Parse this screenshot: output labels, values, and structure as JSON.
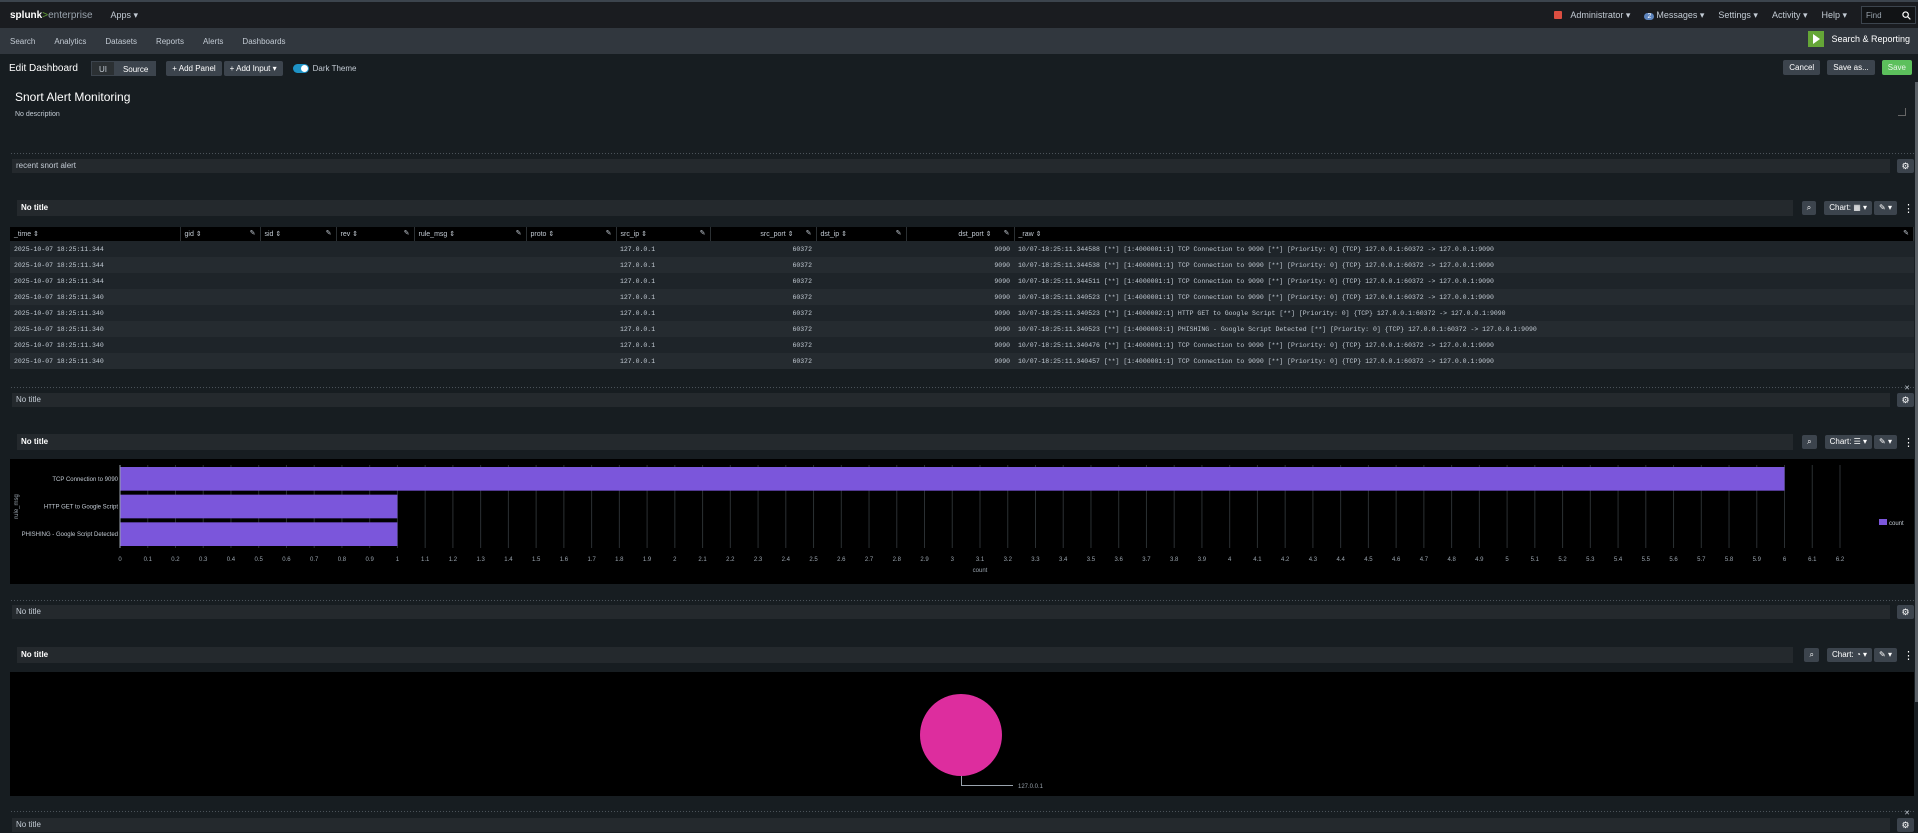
{
  "topbar": {
    "logo_main": "splunk",
    "logo_sep": ">",
    "logo_suffix": "enterprise",
    "apps": "Apps ▾",
    "user": "Administrator ▾",
    "messages_count": "2",
    "messages": "Messages ▾",
    "settings": "Settings ▾",
    "activity": "Activity ▾",
    "help": "Help ▾",
    "find_placeholder": "Find"
  },
  "nav": {
    "items": [
      "Search",
      "Analytics",
      "Datasets",
      "Reports",
      "Alerts",
      "Dashboards"
    ],
    "app_title": "Search & Reporting"
  },
  "editbar": {
    "title": "Edit Dashboard",
    "ui": "UI",
    "source": "Source",
    "add_panel": "+ Add Panel",
    "add_input": "+ Add Input ▾",
    "dark_theme": "Dark Theme",
    "cancel": "Cancel",
    "save_as": "Save as...",
    "save": "Save"
  },
  "dashboard": {
    "title": "Snort Alert Monitoring",
    "description": "No description"
  },
  "rows": [
    {
      "row_title": "recent snort alert",
      "panel_title": "No title",
      "chart_label": "Chart: ▦ ▾"
    },
    {
      "row_title": "No title",
      "panel_title": "No title",
      "chart_label": "Chart: ☰ ▾"
    },
    {
      "row_title": "No title",
      "panel_title": "No title",
      "chart_label": "Chart: ◔ ▾"
    },
    {
      "row_title": "No title"
    }
  ],
  "table": {
    "columns": [
      "_time ⇕",
      "gid ⇕",
      "sid ⇕",
      "rev ⇕",
      "rule_msg ⇕",
      "proto ⇕",
      "src_ip ⇕",
      "src_port ⇕",
      "dst_ip ⇕",
      "dst_port ⇕",
      "_raw ⇕"
    ],
    "rows": [
      [
        "2025-10-07 18:25:11.344",
        "127.0.0.1",
        "60372",
        "9090",
        "10/07-18:25:11.344588  [**] [1:4000001:1] TCP Connection to 9090 [**] [Priority: 0] {TCP} 127.0.0.1:60372 -> 127.0.0.1:9090"
      ],
      [
        "2025-10-07 18:25:11.344",
        "127.0.0.1",
        "60372",
        "9090",
        "10/07-18:25:11.344538  [**] [1:4000001:1] TCP Connection to 9090 [**] [Priority: 0] {TCP} 127.0.0.1:60372 -> 127.0.0.1:9090"
      ],
      [
        "2025-10-07 18:25:11.344",
        "127.0.0.1",
        "60372",
        "9090",
        "10/07-18:25:11.344511  [**] [1:4000001:1] TCP Connection to 9090 [**] [Priority: 0] {TCP} 127.0.0.1:60372 -> 127.0.0.1:9090"
      ],
      [
        "2025-10-07 18:25:11.340",
        "127.0.0.1",
        "60372",
        "9090",
        "10/07-18:25:11.340523  [**] [1:4000001:1] TCP Connection to 9090 [**] [Priority: 0] {TCP} 127.0.0.1:60372 -> 127.0.0.1:9090"
      ],
      [
        "2025-10-07 18:25:11.340",
        "127.0.0.1",
        "60372",
        "9090",
        "10/07-18:25:11.340523  [**] [1:4000002:1] HTTP GET to Google Script [**] [Priority: 0] {TCP} 127.0.0.1:60372 -> 127.0.0.1:9090"
      ],
      [
        "2025-10-07 18:25:11.340",
        "127.0.0.1",
        "60372",
        "9090",
        "10/07-18:25:11.340523  [**] [1:4000003:1] PHISHING - Google Script Detected [**] [Priority: 0] {TCP} 127.0.0.1:60372 -> 127.0.0.1:9090"
      ],
      [
        "2025-10-07 18:25:11.340",
        "127.0.0.1",
        "60372",
        "9090",
        "10/07-18:25:11.340476  [**] [1:4000001:1] TCP Connection to 9090 [**] [Priority: 0] {TCP} 127.0.0.1:60372 -> 127.0.0.1:9090"
      ],
      [
        "2025-10-07 18:25:11.340",
        "127.0.0.1",
        "60372",
        "9090",
        "10/07-18:25:11.340457  [**] [1:4000001:1] TCP Connection to 9090 [**] [Priority: 0] {TCP} 127.0.0.1:60372 -> 127.0.0.1:9090"
      ]
    ]
  },
  "chart_data": [
    {
      "type": "bar",
      "orientation": "horizontal",
      "categories": [
        "TCP Connection to 9090",
        "HTTP GET to Google Script",
        "PHISHING - Google Script Detected"
      ],
      "values": [
        6,
        1,
        1
      ],
      "xlabel": "count",
      "ylabel": "rule_msg",
      "xlim": [
        0,
        6.2
      ],
      "tick_step": 0.1,
      "legend": [
        "count"
      ],
      "legend_position": "right",
      "color": "#7b56db",
      "grid": true
    },
    {
      "type": "pie",
      "categories": [
        "127.0.0.1"
      ],
      "values": [
        8
      ],
      "color": "#dd2d9e"
    }
  ]
}
